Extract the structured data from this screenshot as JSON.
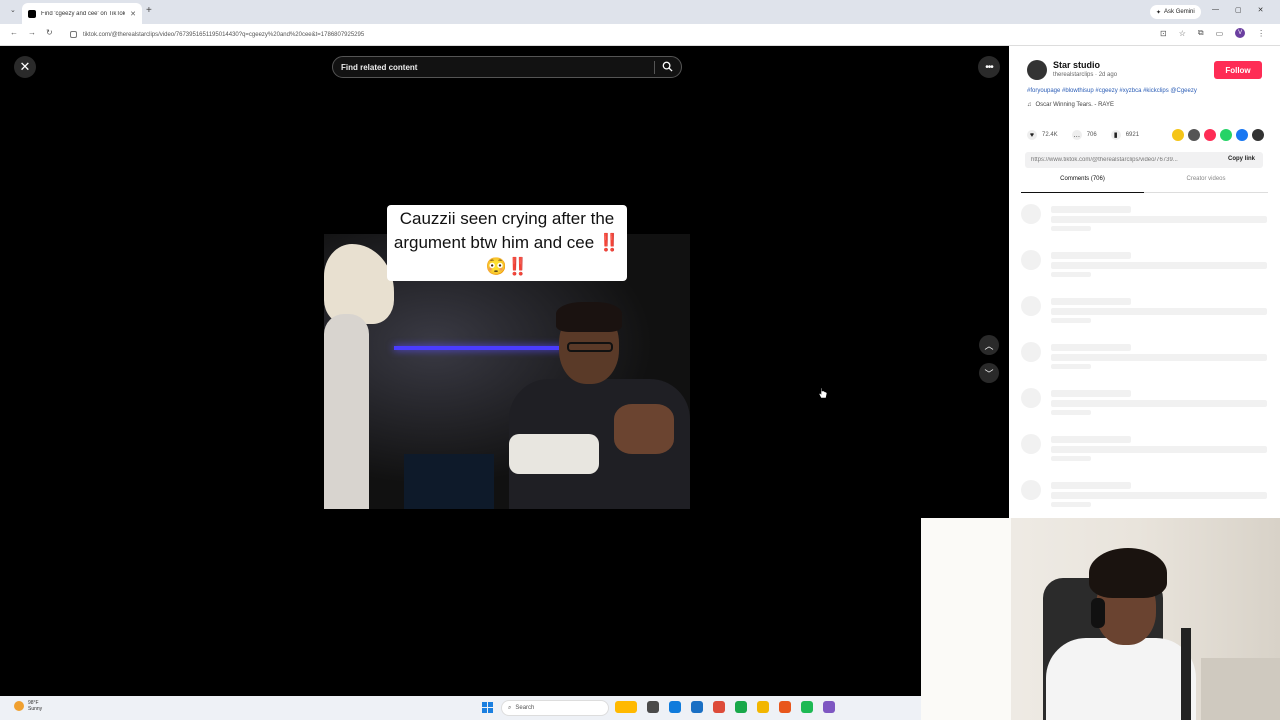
{
  "browser": {
    "tab_title": "Find 'cgeezy and cee' on TikTok",
    "new_tab": "+",
    "url": "tiktok.com/@therealstarclips/video/7673951651195014430?q=cgeezy%20and%20cee&t=1786807925295",
    "gemini_label": "Ask Gemini",
    "profile_initial": "V"
  },
  "player": {
    "search_placeholder": "Find related content",
    "caption": "Cauzzii seen crying after the argument btw him and cee ‼️😳‼️"
  },
  "creator": {
    "name": "Star studio",
    "handle": "therealstarclips",
    "posted": "2d ago",
    "follow_label": "Follow",
    "hashtags": "#foryoupage #blowthisup #cgeezy #xyzbca #kickclips @Cgeezy",
    "music": "Oscar Winning Tears. - RAYE"
  },
  "stats": {
    "likes": "72.4K",
    "comments": "706",
    "saves": "6921"
  },
  "share_colors": [
    "#f5c518",
    "#555555",
    "#fe2c55",
    "#25d366",
    "#1877f2",
    "#333333"
  ],
  "link": {
    "url": "https://www.tiktok.com/@therealstarclips/video/76739...",
    "copy_label": "Copy link"
  },
  "tabs": {
    "comments": "Comments (706)",
    "creator_videos": "Creator videos"
  },
  "taskbar": {
    "temp": "98°F",
    "condition": "Sunny",
    "search": "Search",
    "app_colors": [
      "#ffb900",
      "#4a4a4a",
      "#0f7bdc",
      "#1a6fc4",
      "#dd4b39",
      "#18a84a",
      "#f2b600",
      "#e8561c",
      "#1db954",
      "#7e57c2"
    ]
  },
  "icons": {
    "close": "close-icon",
    "more": "more-icon",
    "search": "search-icon",
    "up": "chevron-up-icon",
    "down": "chevron-down-icon"
  }
}
